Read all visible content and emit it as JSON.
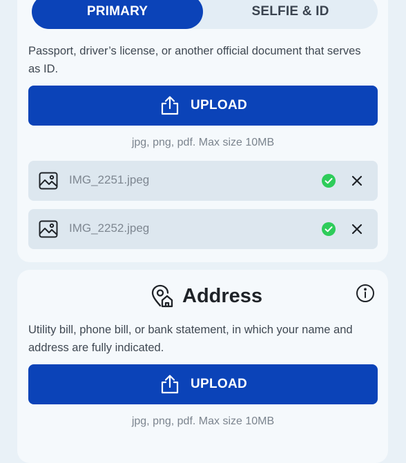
{
  "tabs": {
    "primary": "PRIMARY",
    "selfie_id": "SELFIE & ID"
  },
  "identity": {
    "description": "Passport, driver’s license, or another official document that serves as ID.",
    "upload_label": "UPLOAD",
    "hint": "jpg, png, pdf. Max size 10MB",
    "files": [
      {
        "name": "IMG_2251.jpeg",
        "icon": "image-icon",
        "status": "uploaded"
      },
      {
        "name": "IMG_2252.jpeg",
        "icon": "image-icon",
        "status": "uploaded"
      }
    ]
  },
  "address": {
    "title": "Address",
    "icon": "location-home-icon",
    "description": "Utility bill, phone bill, or bank statement, in which your name and address are fully indicated.",
    "upload_label": "UPLOAD",
    "hint": "jpg, png, pdf. Max size 10MB"
  },
  "colors": {
    "primary": "#0b43b8",
    "success": "#2ecc5a",
    "background": "#e9f1f7",
    "card": "#f5f9fc"
  }
}
